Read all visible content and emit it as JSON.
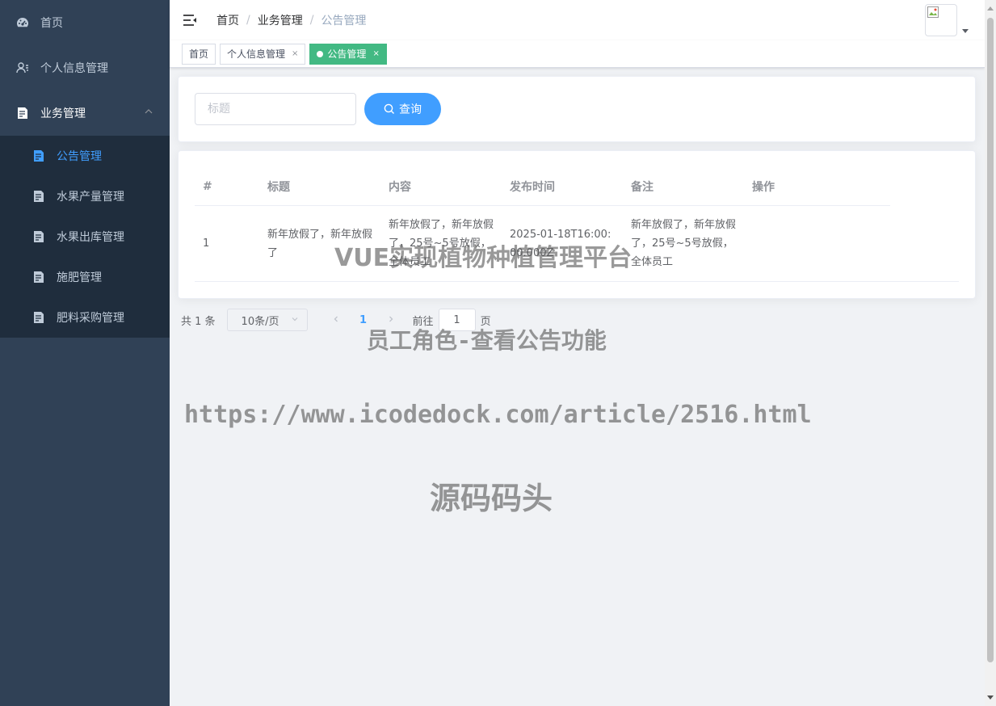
{
  "sidebar": {
    "items": [
      {
        "label": "首页",
        "icon": "dashboard-icon"
      },
      {
        "label": "个人信息管理",
        "icon": "user-icon"
      },
      {
        "label": "业务管理",
        "icon": "document-icon"
      }
    ],
    "submenu": [
      {
        "label": "公告管理",
        "active": true
      },
      {
        "label": "水果产量管理"
      },
      {
        "label": "水果出库管理"
      },
      {
        "label": "施肥管理"
      },
      {
        "label": "肥料采购管理"
      }
    ]
  },
  "header": {
    "breadcrumb": [
      "首页",
      "业务管理",
      "公告管理"
    ],
    "sep": "/"
  },
  "tags": [
    {
      "label": "首页"
    },
    {
      "label": "个人信息管理",
      "close": "×"
    },
    {
      "label": "公告管理",
      "close": "×",
      "active": true
    }
  ],
  "search": {
    "placeholder": "标题",
    "button_label": "查询"
  },
  "table": {
    "columns": [
      "#",
      "标题",
      "内容",
      "发布时间",
      "备注",
      "操作"
    ],
    "rows": [
      [
        "1",
        "新年放假了，新年放假了",
        "新年放假了，新年放假了，25号~5号放假，全体员工",
        "2025-01-18T16:00:00.000Z",
        "新年放假了，新年放假了，25号~5号放假，全体员工",
        ""
      ]
    ]
  },
  "pagination": {
    "total": "共 1 条",
    "page_size": "10条/页",
    "current": "1",
    "goto_prefix": "前往",
    "goto_value": "1",
    "goto_suffix": "页"
  },
  "watermarks": {
    "line1": "VUE实现植物种植管理平台",
    "line2": "员工角色-查看公告功能",
    "line3": "https://www.icodedock.com/article/2516.html",
    "line4": "源码码头"
  },
  "colors": {
    "sidebar_bg": "#304156",
    "submenu_bg": "#1f2d3d",
    "accent": "#409eff",
    "tag_active": "#42b983"
  }
}
